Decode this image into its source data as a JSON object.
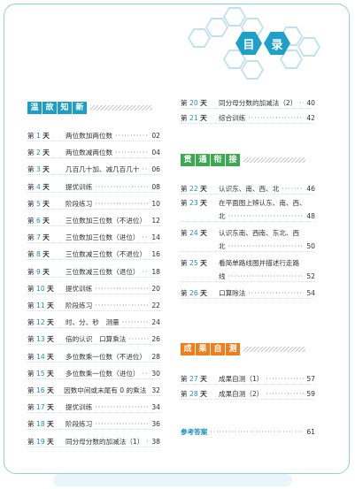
{
  "header": {
    "title_chars": [
      "目",
      "录"
    ]
  },
  "sections": {
    "left": {
      "tag_chars": [
        "温",
        "故",
        "知",
        "新"
      ]
    },
    "mid": {
      "tag_chars": [
        "贯",
        "通",
        "衔",
        "接"
      ]
    },
    "bottom": {
      "tag_chars": [
        "成",
        "果",
        "自",
        "测"
      ]
    }
  },
  "day_suffix": "天",
  "day_prefix": "第",
  "left_entries": [
    {
      "n": "1",
      "title": "两位数加两位数",
      "page": "02"
    },
    {
      "n": "2",
      "title": "两位数减两位数",
      "page": "04"
    },
    {
      "n": "3",
      "title": "几百几十加、减几百几十",
      "page": "06"
    },
    {
      "n": "4",
      "title": "提优训练",
      "page": "08"
    },
    {
      "n": "5",
      "title": "阶段练习",
      "page": "10"
    },
    {
      "n": "6",
      "title": "三位数加三位数（不进位）",
      "page": "12"
    },
    {
      "n": "7",
      "title": "三位数加三位数（进位）",
      "page": "14"
    },
    {
      "n": "8",
      "title": "三位数减三位数（不退位）",
      "page": "16"
    },
    {
      "n": "9",
      "title": "三位数减三位数（退位）",
      "page": "18"
    },
    {
      "n": "10",
      "title": "提优训练",
      "page": "20"
    },
    {
      "n": "11",
      "title": "阶段练习",
      "page": "22"
    },
    {
      "n": "12",
      "title": "时、分、秒　测量",
      "page": "24"
    },
    {
      "n": "13",
      "title": "倍的认识　口算乘法",
      "page": "26"
    },
    {
      "n": "14",
      "title": "多位数乘一位数（不进位）",
      "page": "28"
    },
    {
      "n": "15",
      "title": "多位数乘一位数（进位）",
      "page": "30"
    },
    {
      "n": "16",
      "title": "因数中间或末尾有 0 的乘法",
      "page": "32"
    },
    {
      "n": "17",
      "title": "提优训练",
      "page": "34"
    },
    {
      "n": "18",
      "title": "阶段练习",
      "page": "36"
    },
    {
      "n": "19",
      "title": "同分母分数的加减法（1）",
      "page": "38"
    }
  ],
  "right_top_entries": [
    {
      "n": "20",
      "title": "同分母分数的加减法（2）",
      "page": "40"
    },
    {
      "n": "21",
      "title": "综合训练",
      "page": "42"
    }
  ],
  "right_mid_entries": [
    {
      "n": "22",
      "title": "认识东、南、西、北",
      "page": "46",
      "cont": ""
    },
    {
      "n": "23",
      "title": "在平面图上辨认东、南、西、",
      "page": "48",
      "cont": "北"
    },
    {
      "n": "24",
      "title": "认识东南、西南、东北、西",
      "page": "50",
      "cont": "北"
    },
    {
      "n": "25",
      "title": "看简单路线图并描述行走路",
      "page": "52",
      "cont": "线"
    },
    {
      "n": "26",
      "title": "口算除法",
      "page": "54",
      "cont": ""
    }
  ],
  "right_bottom_entries": [
    {
      "n": "27",
      "title": "成果自测（1）",
      "page": "57"
    },
    {
      "n": "28",
      "title": "成果自测（2）",
      "page": "59"
    }
  ],
  "answers": {
    "label": "参考答案",
    "page": "61"
  }
}
